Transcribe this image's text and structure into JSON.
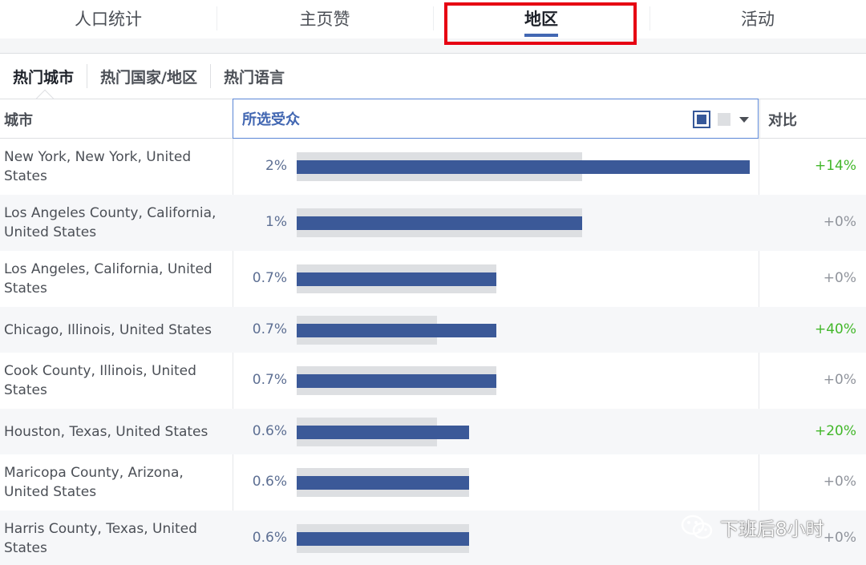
{
  "top_tabs": [
    {
      "label": "人口统计"
    },
    {
      "label": "主页赞"
    },
    {
      "label": "地区"
    },
    {
      "label": "活动"
    }
  ],
  "sub_tabs": [
    {
      "label": "热门城市"
    },
    {
      "label": "热门国家/地区"
    },
    {
      "label": "热门语言"
    }
  ],
  "table": {
    "col_city": "城市",
    "col_audience": "所选受众",
    "col_compare": "对比",
    "rows": [
      {
        "city": "New York, New York, United States",
        "pct": "2%",
        "selected_level": 1.0,
        "baseline_level": 0.63,
        "compare": "+14%"
      },
      {
        "city": "Los Angeles County, California, United States",
        "pct": "1%",
        "selected_level": 0.63,
        "baseline_level": 0.63,
        "compare": "+0%"
      },
      {
        "city": "Los Angeles, California, United States",
        "pct": "0.7%",
        "selected_level": 0.44,
        "baseline_level": 0.44,
        "compare": "+0%"
      },
      {
        "city": "Chicago, Illinois, United States",
        "pct": "0.7%",
        "selected_level": 0.44,
        "baseline_level": 0.31,
        "compare": "+40%"
      },
      {
        "city": "Cook County, Illinois, United States",
        "pct": "0.7%",
        "selected_level": 0.44,
        "baseline_level": 0.44,
        "compare": "+0%"
      },
      {
        "city": "Houston, Texas, United States",
        "pct": "0.6%",
        "selected_level": 0.38,
        "baseline_level": 0.31,
        "compare": "+20%"
      },
      {
        "city": "Maricopa County, Arizona, United States",
        "pct": "0.6%",
        "selected_level": 0.38,
        "baseline_level": 0.38,
        "compare": "+0%"
      },
      {
        "city": "Harris County, Texas, United States",
        "pct": "0.6%",
        "selected_level": 0.38,
        "baseline_level": 0.38,
        "compare": "+0%"
      }
    ]
  },
  "colors": {
    "selected_bar": "#3b5998",
    "baseline_bar": "#dddfe2",
    "positive": "#42b72a",
    "neutral": "#90949c",
    "highlight": "#e60012"
  },
  "watermark": {
    "text": "下班后8小时",
    "icon": "wechat-icon"
  }
}
